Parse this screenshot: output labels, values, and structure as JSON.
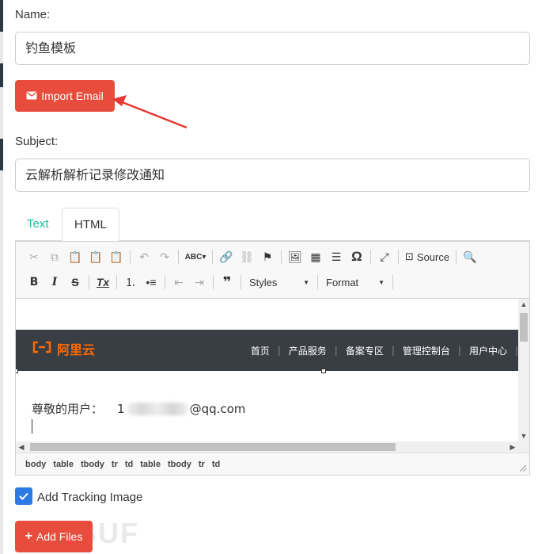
{
  "form": {
    "name_label": "Name:",
    "name_value": "钓鱼模板",
    "import_button": "Import Email",
    "subject_label": "Subject:",
    "subject_value": "云解析解析记录修改通知"
  },
  "tabs": [
    {
      "label": "Text",
      "active": false
    },
    {
      "label": "HTML",
      "active": true
    }
  ],
  "toolbar": {
    "source_label": "Source",
    "styles_label": "Styles",
    "format_label": "Format"
  },
  "email": {
    "logo_text": "阿里云",
    "nav": [
      "首页",
      "产品服务",
      "备案专区",
      "管理控制台",
      "用户中心"
    ],
    "greeting_prefix": "尊敬的用户：",
    "greeting_digit": "1",
    "greeting_suffix": "@qq.com"
  },
  "path": [
    "body",
    "table",
    "tbody",
    "tr",
    "td",
    "table",
    "tbody",
    "tr",
    "td"
  ],
  "tracking": {
    "label": "Add Tracking Image",
    "checked": true
  },
  "files": {
    "button": "Add Files"
  },
  "watermark": "EBUF",
  "colors": {
    "accent_red": "#e74c3c",
    "tab_active_text": "#1abc9c",
    "checkbox": "#2c7be5",
    "aliyun_orange": "#ff6a00"
  }
}
